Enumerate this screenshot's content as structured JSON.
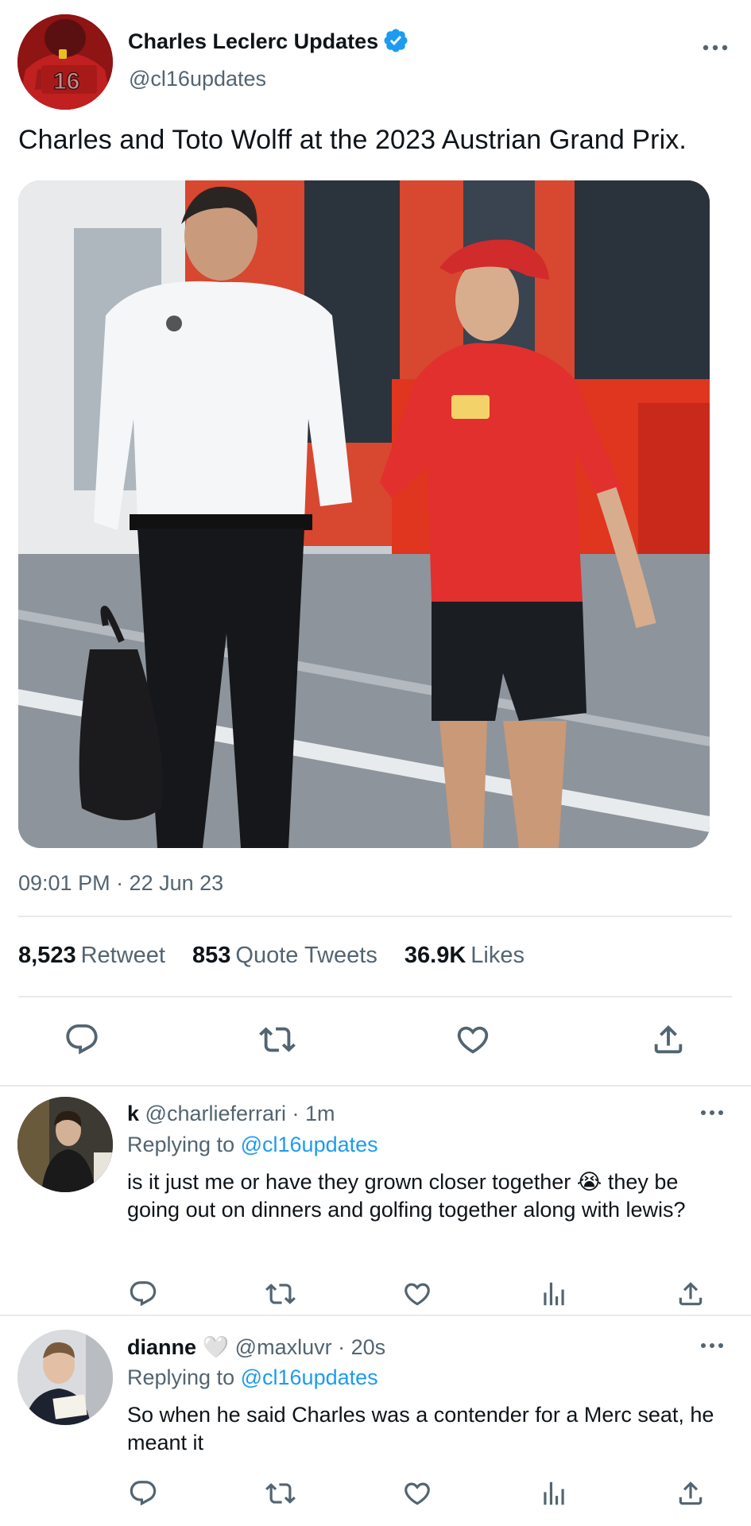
{
  "tweet": {
    "author_name": "Charles Leclerc Updates",
    "author_handle": "@cl16updates",
    "avatar_number": "16",
    "text": "Charles and Toto Wolff at the 2023 Austrian Grand Prix.",
    "timestamp": "09:01 PM · 22 Jun 23",
    "stats": [
      {
        "value": "8,523",
        "label": "Retweet"
      },
      {
        "value": "853",
        "label": "Quote Tweets"
      },
      {
        "value": "36.9K",
        "label": "Likes"
      }
    ],
    "actions": [
      "reply-icon",
      "retweet-icon",
      "like-icon",
      "share-icon"
    ]
  },
  "replies": [
    {
      "name": "k",
      "handle": "@charlieferrari",
      "time": "· 1m",
      "replying_label": "Replying to",
      "replying_to": "@cl16updates",
      "text_before_emoji": "is it just me or have they grown closer together",
      "emoji": "😭",
      "text_after_emoji": "they be going out on dinners and golfing together along with lewis?"
    },
    {
      "name": "dianne",
      "heart": "🤍",
      "handle": "@maxluvr",
      "time": "· 20s",
      "replying_label": "Replying to",
      "replying_to": "@cl16updates",
      "text": "So when he said Charles was a contender for a Merc seat, he meant it"
    }
  ],
  "colors": {
    "text": "#0f1419",
    "secondary": "#536471",
    "link": "#1d9bf0",
    "verified": "#1d9bf0",
    "divider": "#e7e9ea"
  }
}
